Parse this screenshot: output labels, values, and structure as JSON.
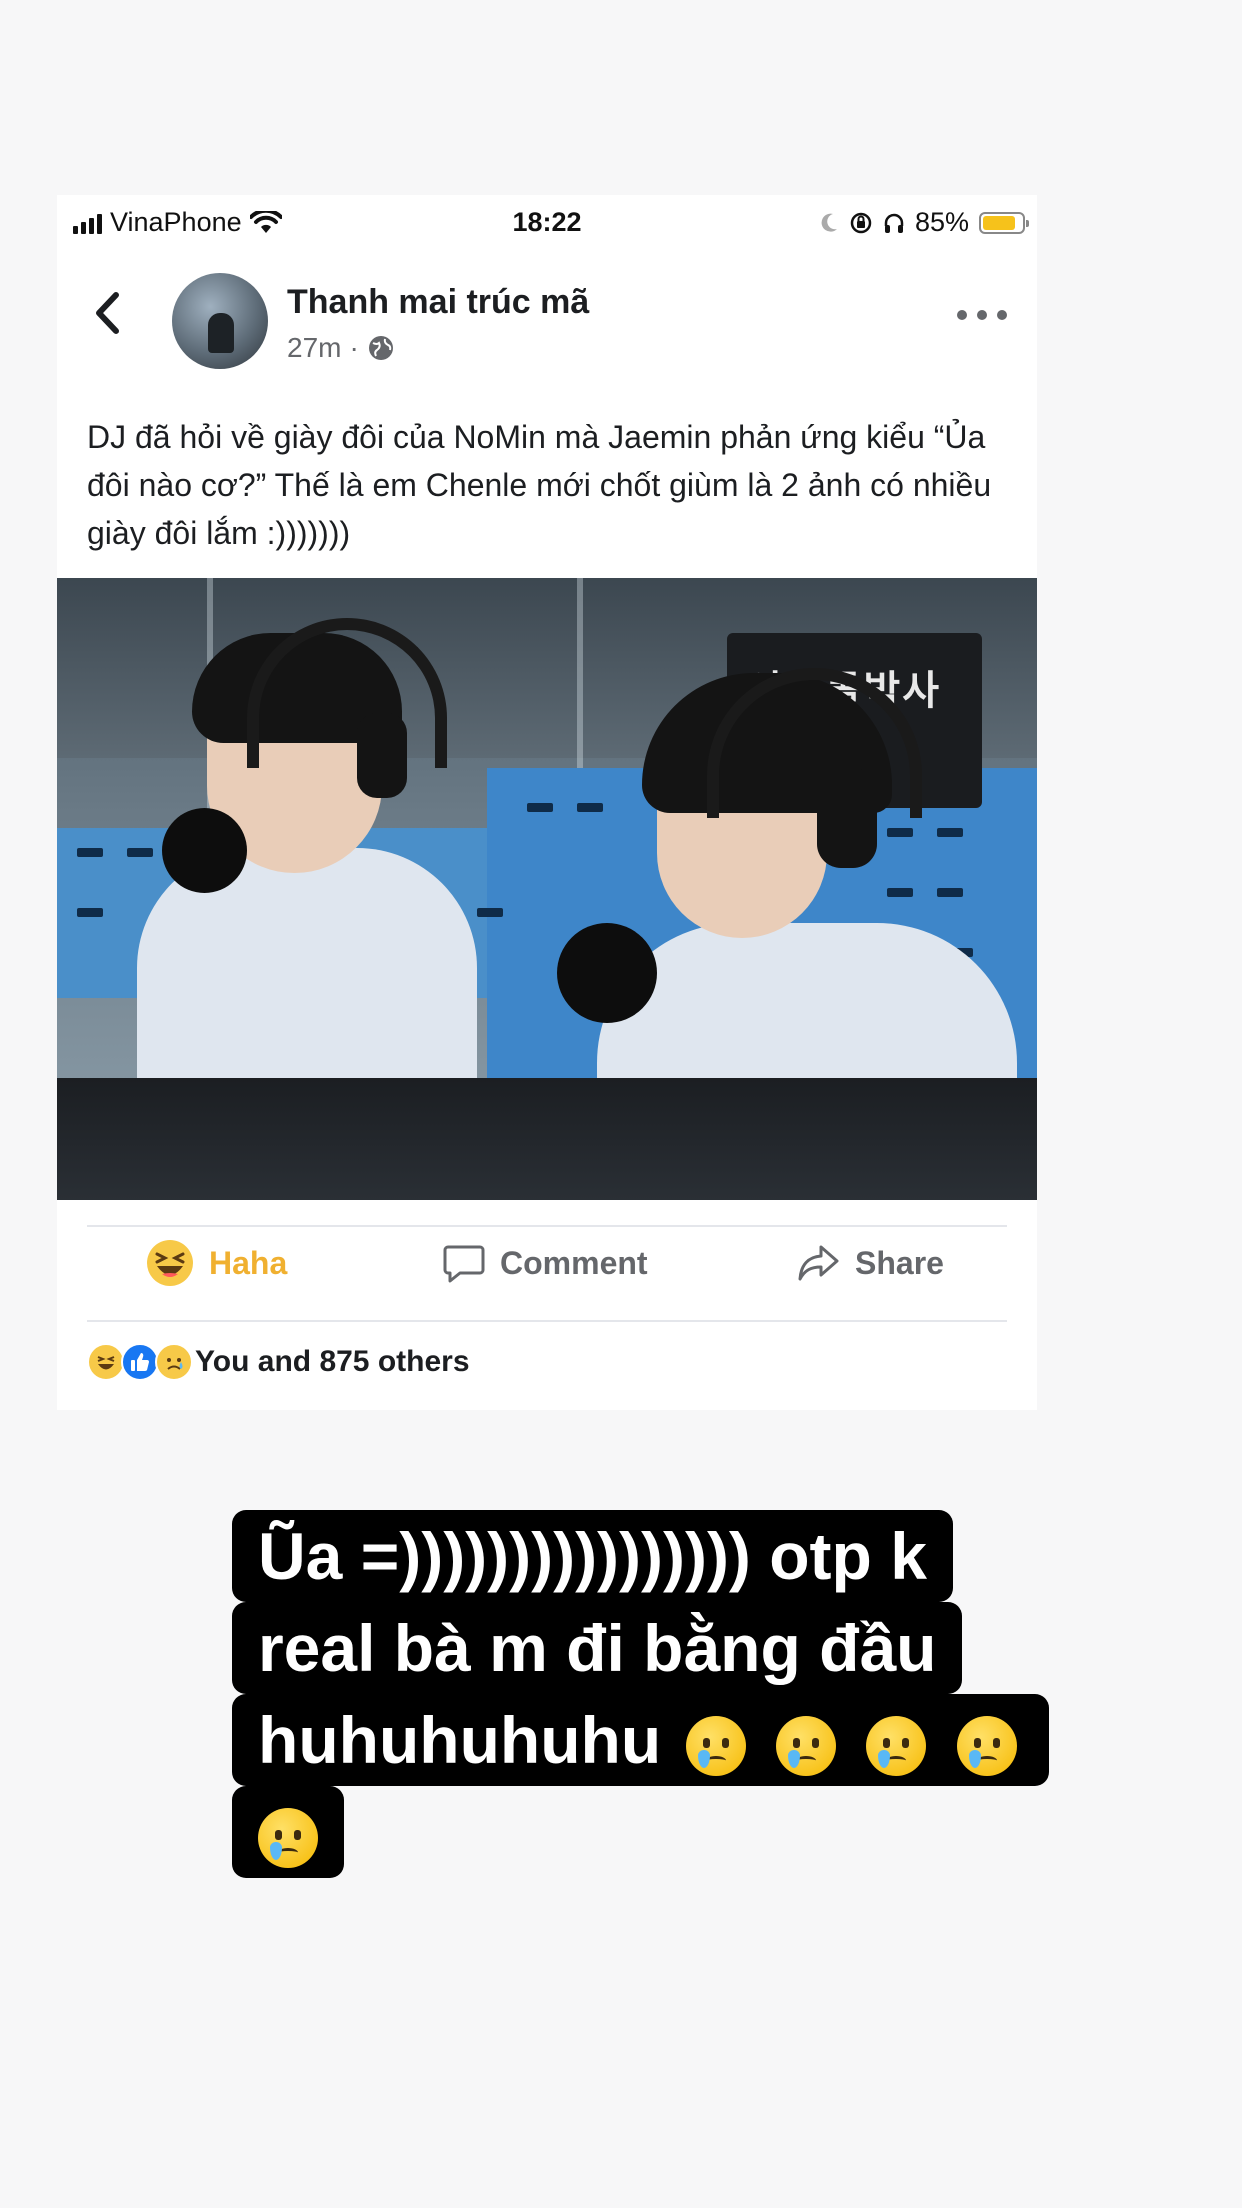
{
  "status_bar": {
    "carrier": "VinaPhone",
    "time": "18:22",
    "battery_percent": "85%",
    "battery_level": 0.85,
    "icons": [
      "signal-icon",
      "wifi-icon",
      "moon-icon",
      "rotation-lock-icon",
      "headphones-icon",
      "battery-icon"
    ]
  },
  "post": {
    "poster_name": "Thanh mai trúc mã",
    "time_ago": "27m",
    "visibility_icon": "globe-icon",
    "text": "DJ đã hỏi về giày đôi của NoMin mà Jaemin phản ứng kiểu “Ủa đôi nào cơ?” Thế là em Chenle mới chốt giùm là 2 ảnh có nhiều giày đôi lắm :)))))))",
    "photo_sign_text": "아이돌박사",
    "actions": {
      "haha": "Haha",
      "comment": "Comment",
      "share": "Share"
    },
    "reactions_summary": "You and 875 others",
    "reaction_icons": [
      "haha-icon",
      "like-icon",
      "sad-icon"
    ]
  },
  "colors": {
    "haha_accent": "#f0b030",
    "muted_text": "#65676b",
    "caption_bg": "#000000",
    "caption_text": "#ffffff"
  },
  "story_caption": {
    "line1": "Ũa =)))))))))))))))) otp k",
    "line2": "real bà m đi bằng đầu",
    "line3_text": "huhuhuhuhu",
    "emoji_name": "face-holding-back-tears-icon"
  }
}
